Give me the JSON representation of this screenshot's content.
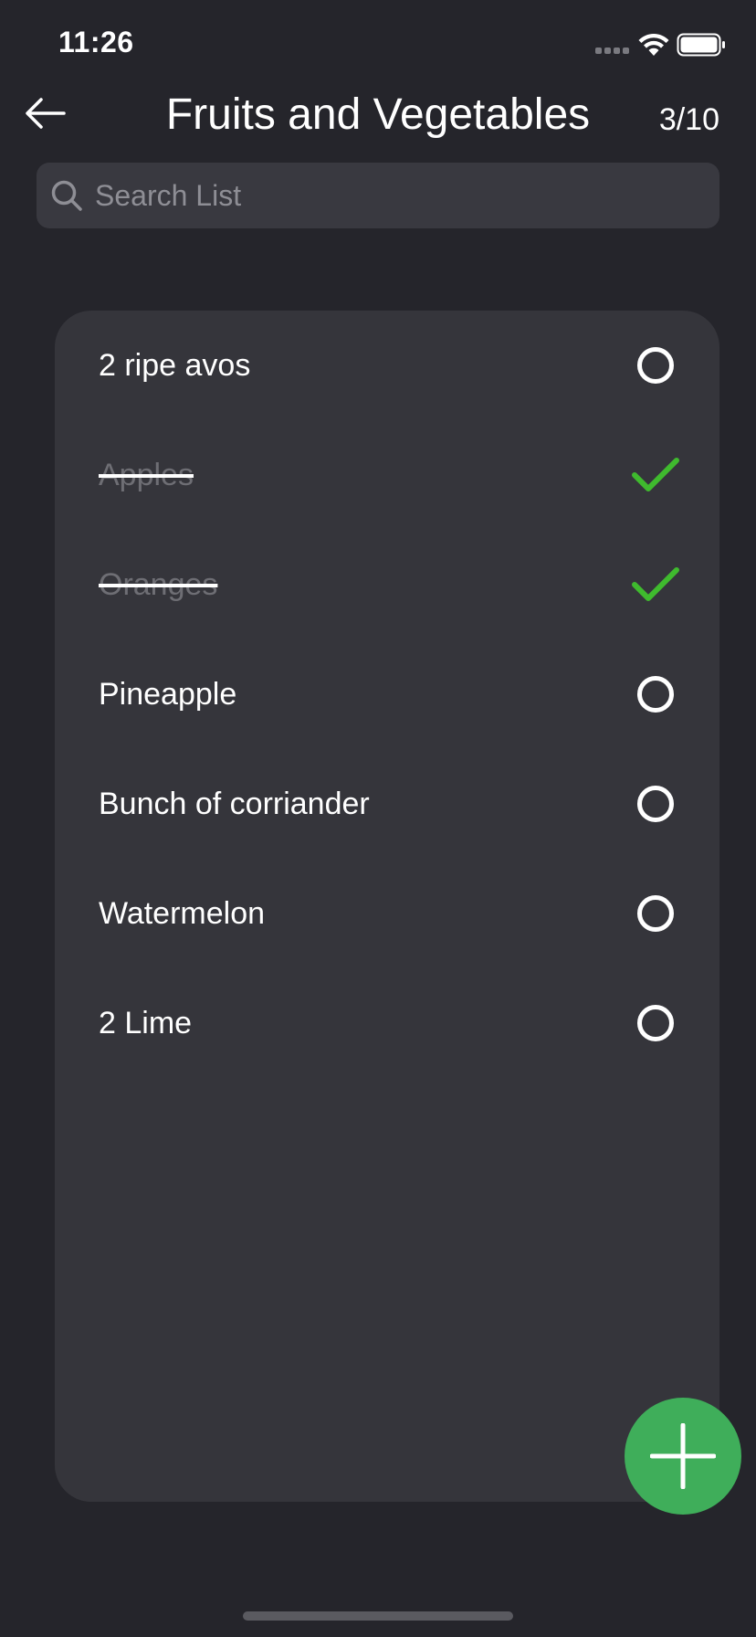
{
  "status_bar": {
    "time": "11:26",
    "icons": [
      "signal-dots-icon",
      "wifi-icon",
      "battery-icon"
    ]
  },
  "header": {
    "back_icon": "arrow-left-icon",
    "title": "Fruits and Vegetables",
    "count": "3/10"
  },
  "search": {
    "icon": "search-icon",
    "placeholder": "Search List",
    "value": ""
  },
  "list": {
    "items": [
      {
        "label": "2 ripe avos",
        "checked": false
      },
      {
        "label": "Apples",
        "checked": true
      },
      {
        "label": "Oranges",
        "checked": true
      },
      {
        "label": "Pineapple",
        "checked": false
      },
      {
        "label": "Bunch of corriander",
        "checked": false
      },
      {
        "label": "Watermelon",
        "checked": false
      },
      {
        "label": "2 Lime",
        "checked": false
      }
    ]
  },
  "fab": {
    "icon": "plus-icon"
  },
  "colors": {
    "background": "#25252b",
    "card": "#35353b",
    "accent_green": "#3fae5a",
    "check_green": "#3fba2e"
  }
}
